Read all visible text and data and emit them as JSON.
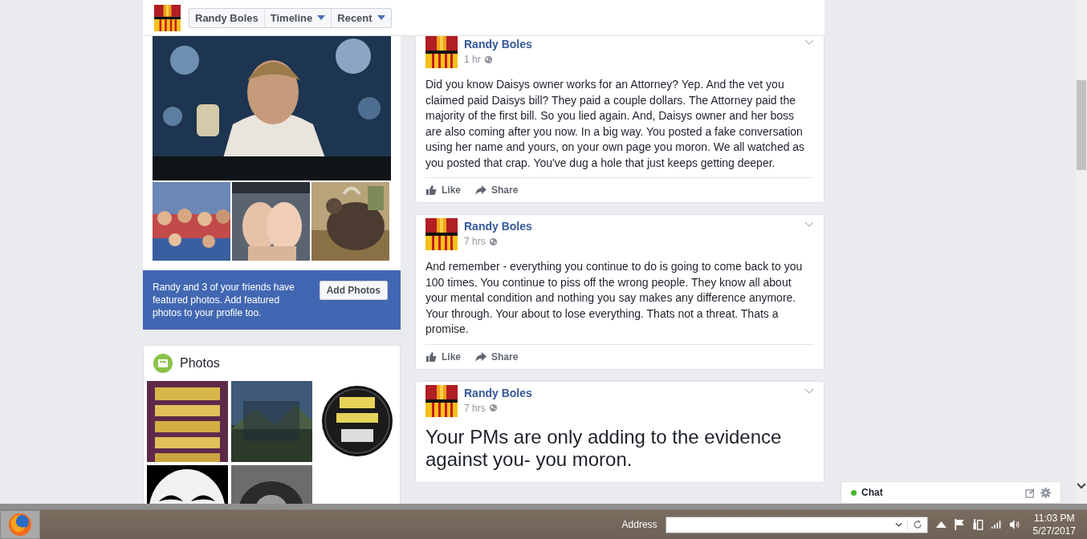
{
  "header": {
    "nav": [
      {
        "label": "Randy Boles",
        "dropdown": false
      },
      {
        "label": "Timeline",
        "dropdown": true
      },
      {
        "label": "Recent",
        "dropdown": true
      }
    ]
  },
  "promo": {
    "text": "Randy and 3 of your friends have featured photos. Add featured photos to your profile too.",
    "button": "Add Photos"
  },
  "photos_card": {
    "title": "Photos"
  },
  "posts": [
    {
      "author": "Randy Boles",
      "time": "1 hr",
      "large_text": false,
      "text": "Did you know Daisys owner works for an Attorney? Yep. And the vet you claimed paid Daisys bill? They paid a couple dollars. The Attorney paid the majority of the first bill. So you lied again. And, Daisys owner and her boss are also coming after you now. In a big way. You posted a fake conversation using her name and yours, on your own page you moron. We all watched as you posted that crap. You've dug a hole that just keeps getting deeper.",
      "actions": [
        "Like",
        "Share"
      ]
    },
    {
      "author": "Randy Boles",
      "time": "7 hrs",
      "large_text": false,
      "text": "And remember - everything you continue to do is going to come back to you 100 times. You continue to piss off the wrong people. They know all about your mental condition and nothing you say makes any difference anymore. Your through. Your about to lose everything. Thats not a threat. Thats a promise.",
      "actions": [
        "Like",
        "Share"
      ]
    },
    {
      "author": "Randy Boles",
      "time": "7 hrs",
      "large_text": true,
      "text": "Your PMs are only adding to the evidence against you- you moron."
    }
  ],
  "chat": {
    "label": "Chat",
    "online": true
  },
  "taskbar": {
    "address_label": "Address",
    "time": "11:03 PM",
    "date": "5/27/2017"
  }
}
